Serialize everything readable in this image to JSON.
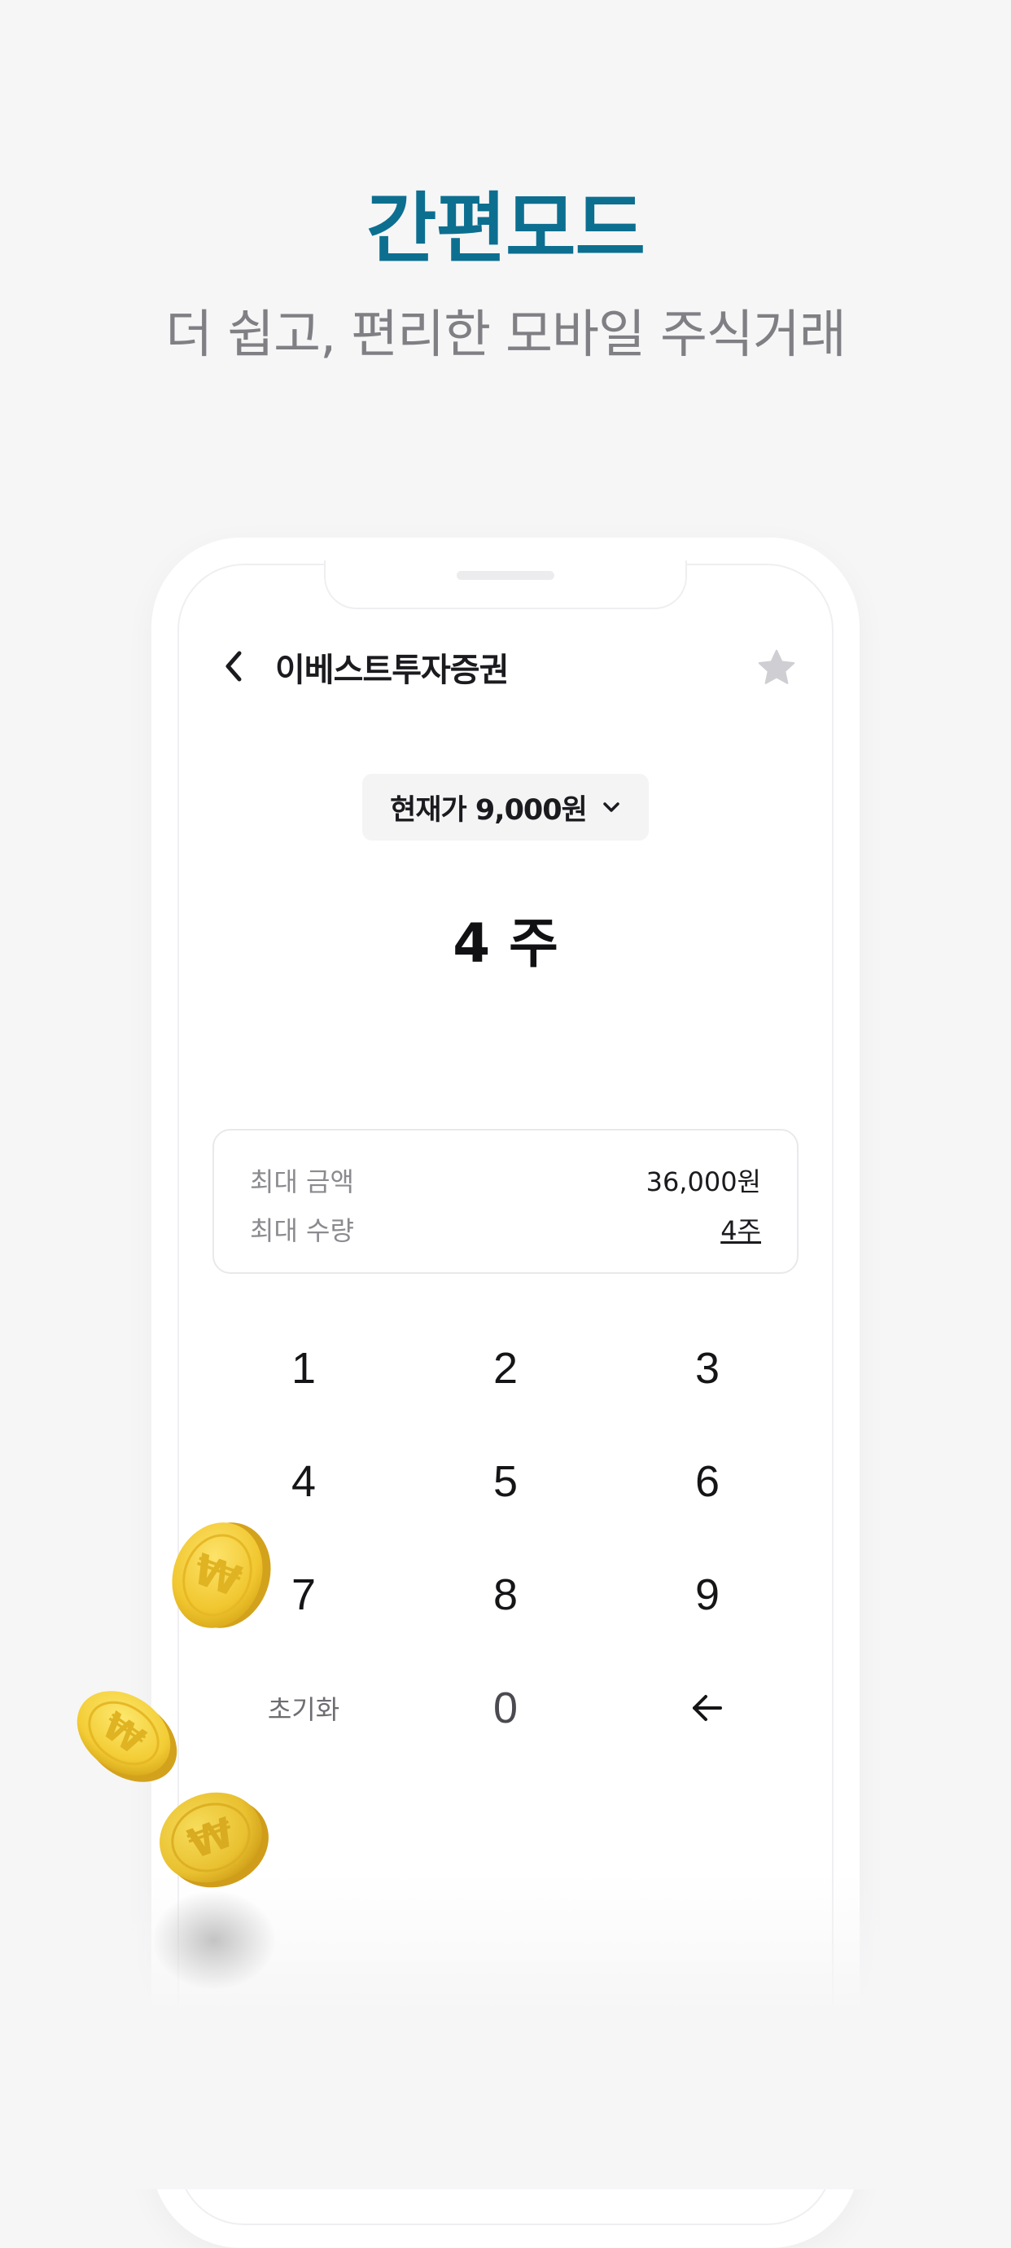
{
  "hero": {
    "title": "간편모드",
    "subtitle": "더 쉽고, 편리한 모바일 주식거래"
  },
  "header": {
    "back_icon": "chevron-left-icon",
    "title": "이베스트투자증권",
    "favorite_icon": "star-icon"
  },
  "price_selector": {
    "label": "현재가 9,000원",
    "icon": "chevron-down-icon"
  },
  "quantity_display": "4 주",
  "info": {
    "max_amount_label": "최대 금액",
    "max_amount_value": "36,000원",
    "max_quantity_label": "최대 수량",
    "max_quantity_value": "4주"
  },
  "keypad": {
    "keys": [
      "1",
      "2",
      "3",
      "4",
      "5",
      "6",
      "7",
      "8",
      "9",
      "초기화",
      "0"
    ],
    "backspace_icon": "arrow-left-icon"
  },
  "colors": {
    "title": "#0c6f90",
    "subtitle": "#7f7f84",
    "background": "#f6f6f7",
    "star": "#cfcfd3",
    "coin": "#f2cf3a"
  }
}
